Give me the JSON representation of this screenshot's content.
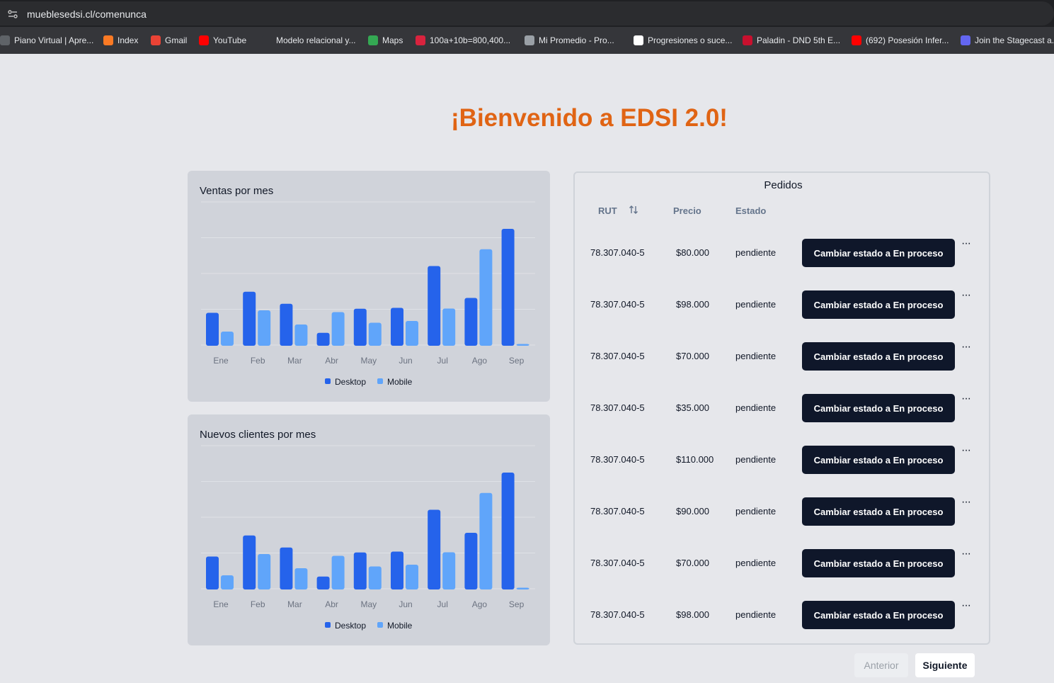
{
  "browser": {
    "url": "mueblesedsi.cl/comenunca",
    "bookmarks": [
      {
        "label": "Piano Virtual | Apre...",
        "icon": "piano-icon",
        "color": "#5f6368"
      },
      {
        "label": "Index",
        "icon": "xampp-icon",
        "color": "#fb7a24"
      },
      {
        "label": "Gmail",
        "icon": "gmail-icon",
        "color": "#ea4335"
      },
      {
        "label": "YouTube",
        "icon": "youtube-icon",
        "color": "#ff0000"
      },
      {
        "label": "Modelo relacional y...",
        "icon": "document-icon",
        "color": "#35363a"
      },
      {
        "label": "Maps",
        "icon": "maps-icon",
        "color": "#34a853"
      },
      {
        "label": "100a+10b=800,400...",
        "icon": "symbolab-icon",
        "color": "#d9233e"
      },
      {
        "label": "Mi Promedio - Pro...",
        "icon": "globe-icon",
        "color": "#9aa0a6"
      },
      {
        "label": "Progresiones o suce...",
        "icon": "progresiones-icon",
        "color": "#ffffff"
      },
      {
        "label": "Paladin - DND 5th E...",
        "icon": "dnd-icon",
        "color": "#c8102e"
      },
      {
        "label": "(692) Posesión Infer...",
        "icon": "youtube-icon",
        "color": "#ff0000"
      },
      {
        "label": "Join the Stagecast a...",
        "icon": "stagecast-icon",
        "color": "#6366f1"
      }
    ]
  },
  "page": {
    "welcome": "¡Bienvenido a EDSI 2.0!"
  },
  "chart_data": [
    {
      "type": "bar",
      "title": "Ventas por mes",
      "categories": [
        "Ene",
        "Feb",
        "Mar",
        "Abr",
        "May",
        "Jun",
        "Jul",
        "Ago",
        "Sep"
      ],
      "series": [
        {
          "name": "Desktop",
          "color": "#2563eb",
          "values": [
            186,
            305,
            237,
            73,
            209,
            214,
            450,
            270,
            660
          ]
        },
        {
          "name": "Mobile",
          "color": "#60a5fa",
          "values": [
            80,
            200,
            120,
            190,
            130,
            140,
            210,
            545,
            10
          ]
        }
      ],
      "ylim": [
        0,
        800
      ],
      "grid": true,
      "legend": "bottom"
    },
    {
      "type": "bar",
      "title": "Nuevos clientes por mes",
      "categories": [
        "Ene",
        "Feb",
        "Mar",
        "Abr",
        "May",
        "Jun",
        "Jul",
        "Ago",
        "Sep"
      ],
      "series": [
        {
          "name": "Desktop",
          "color": "#2563eb",
          "values": [
            186,
            305,
            237,
            73,
            209,
            214,
            450,
            320,
            660
          ]
        },
        {
          "name": "Mobile",
          "color": "#60a5fa",
          "values": [
            80,
            200,
            120,
            190,
            130,
            140,
            210,
            545,
            10
          ]
        }
      ],
      "ylim": [
        0,
        800
      ],
      "grid": true,
      "legend": "bottom"
    }
  ],
  "orders": {
    "title": "Pedidos",
    "headers": {
      "rut": "RUT",
      "precio": "Precio",
      "estado": "Estado"
    },
    "action_label": "Cambiar estado a En proceso",
    "more_label": "···",
    "rows": [
      {
        "rut": "78.307.040-5",
        "precio": "$80.000",
        "estado": "pendiente"
      },
      {
        "rut": "78.307.040-5",
        "precio": "$98.000",
        "estado": "pendiente"
      },
      {
        "rut": "78.307.040-5",
        "precio": "$70.000",
        "estado": "pendiente"
      },
      {
        "rut": "78.307.040-5",
        "precio": "$35.000",
        "estado": "pendiente"
      },
      {
        "rut": "78.307.040-5",
        "precio": "$110.000",
        "estado": "pendiente"
      },
      {
        "rut": "78.307.040-5",
        "precio": "$90.000",
        "estado": "pendiente"
      },
      {
        "rut": "78.307.040-5",
        "precio": "$70.000",
        "estado": "pendiente"
      },
      {
        "rut": "78.307.040-5",
        "precio": "$98.000",
        "estado": "pendiente"
      }
    ],
    "pagination": {
      "prev": "Anterior",
      "next": "Siguiente"
    }
  }
}
